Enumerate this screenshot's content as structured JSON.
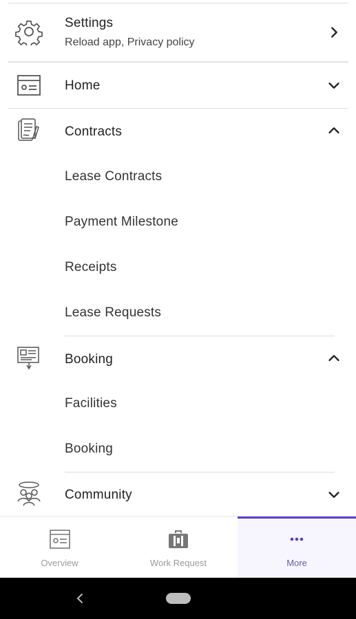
{
  "menu": {
    "settings": {
      "label": "Settings",
      "sublabel": "Reload app, Privacy policy",
      "icon": "gear-icon"
    },
    "home": {
      "label": "Home",
      "icon": "id-card-icon",
      "expanded": false
    },
    "contracts": {
      "label": "Contracts",
      "icon": "contract-document-icon",
      "expanded": true,
      "items": [
        "Lease Contracts",
        "Payment Milestone",
        "Receipts",
        "Lease Requests"
      ]
    },
    "booking": {
      "label": "Booking",
      "icon": "booking-board-icon",
      "expanded": true,
      "items": [
        "Facilities",
        "Booking"
      ]
    },
    "community": {
      "label": "Community",
      "icon": "community-people-icon",
      "expanded": false
    }
  },
  "bottom_nav": {
    "items": [
      {
        "label": "Overview",
        "icon": "id-card-icon",
        "active": false
      },
      {
        "label": "Work Request",
        "icon": "toolbox-icon",
        "active": false
      },
      {
        "label": "More",
        "icon": "more-dots-icon",
        "active": true
      }
    ],
    "accent_color": "#5b3fc4"
  },
  "system_nav": {
    "back_icon": "back-chevron-icon",
    "home_icon": "home-pill-icon"
  }
}
